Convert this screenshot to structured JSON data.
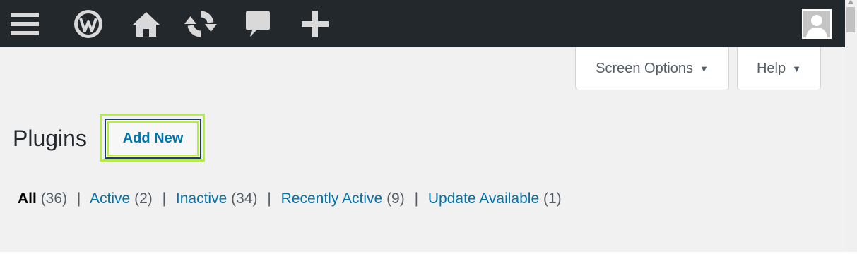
{
  "admin_bar": {
    "items": [
      "menu-icon",
      "wordpress-logo-icon",
      "home-icon",
      "updates-icon",
      "comments-icon",
      "new-content-icon"
    ],
    "avatar": "user-avatar-icon",
    "background": "#23282d"
  },
  "screen_meta": {
    "screen_options_label": "Screen Options",
    "help_label": "Help",
    "arrow": "▼"
  },
  "page": {
    "title": "Plugins",
    "add_new_label": "Add New"
  },
  "filters": [
    {
      "label": "All",
      "count": "(36)",
      "current": true
    },
    {
      "label": "Active",
      "count": "(2)",
      "current": false
    },
    {
      "label": "Inactive",
      "count": "(34)",
      "current": false
    },
    {
      "label": "Recently Active",
      "count": "(9)",
      "current": false
    },
    {
      "label": "Update Available",
      "count": "(1)",
      "current": false
    }
  ],
  "separator": "|",
  "colors": {
    "link": "#0073aa",
    "highlight": "#b4ef3d",
    "background": "#f1f1f1"
  }
}
